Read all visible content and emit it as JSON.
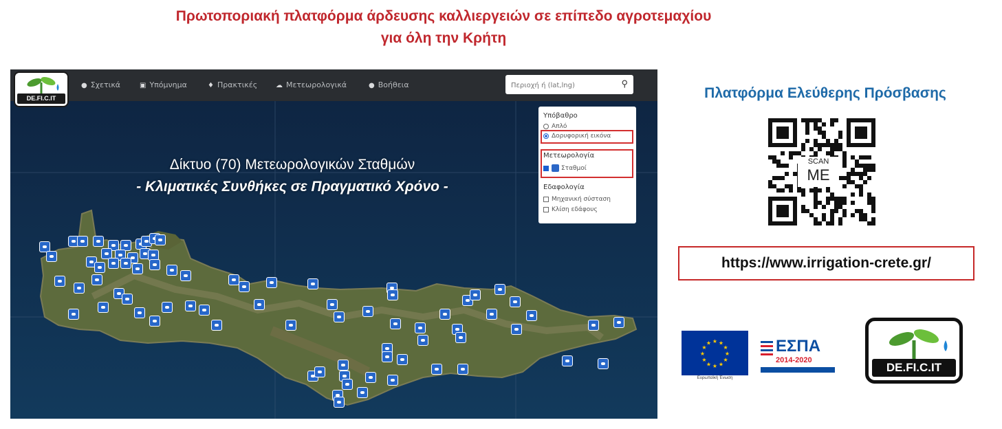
{
  "header": {
    "title_line1": "Πρωτοποριακή πλατφόρμα άρδευσης καλλιεργειών σε επίπεδο αγροτεμαχίου",
    "title_line2": "για όλη την Κρήτη"
  },
  "map": {
    "logo_text": "DE.FI.C.IT",
    "nav": [
      {
        "icon": "info-icon",
        "label": "Σχετικά"
      },
      {
        "icon": "image-icon",
        "label": "Υπόμνημα"
      },
      {
        "icon": "drop-icon",
        "label": "Πρακτικές"
      },
      {
        "icon": "cloud-icon",
        "label": "Μετεωρολογικά"
      },
      {
        "icon": "help-icon",
        "label": "Βοήθεια"
      }
    ],
    "search_placeholder": "Περιοχή ή (lat,lng)",
    "headline_line1": "Δίκτυο (70) Μετεωρολογικών Σταθμών",
    "headline_line2": "- Κλιματικές Συνθήκες σε Πραγματικό Χρόνο -",
    "layers": {
      "basemap_title": "Υπόβαθρο",
      "basemap_options": [
        "Απλό",
        "Δορυφορική εικόνα"
      ],
      "basemap_selected": "Δορυφορική εικόνα",
      "meteo_title": "Μετεωρολογία",
      "meteo_option": "Σταθμοί",
      "soil_title": "Εδαφολογία",
      "soil_options": [
        "Μηχανική σύσταση",
        "Κλίση εδάφους"
      ]
    }
  },
  "right": {
    "access_title": "Πλατφόρμα Ελεύθερης Πρόσβασης",
    "qr_scan": "SCAN",
    "qr_me": "ME",
    "url": "https://www.irrigation-crete.gr/",
    "espa_name": "ΕΣΠΑ",
    "espa_years": "2014-2020",
    "eu_caption": "Ευρωπαϊκή Ένωση",
    "logo_text": "DE.FI.C.IT"
  },
  "colors": {
    "title_red": "#c0272d",
    "access_blue": "#1e6aa8",
    "marker_blue": "#2767c9",
    "navbar": "#2a2d31"
  }
}
